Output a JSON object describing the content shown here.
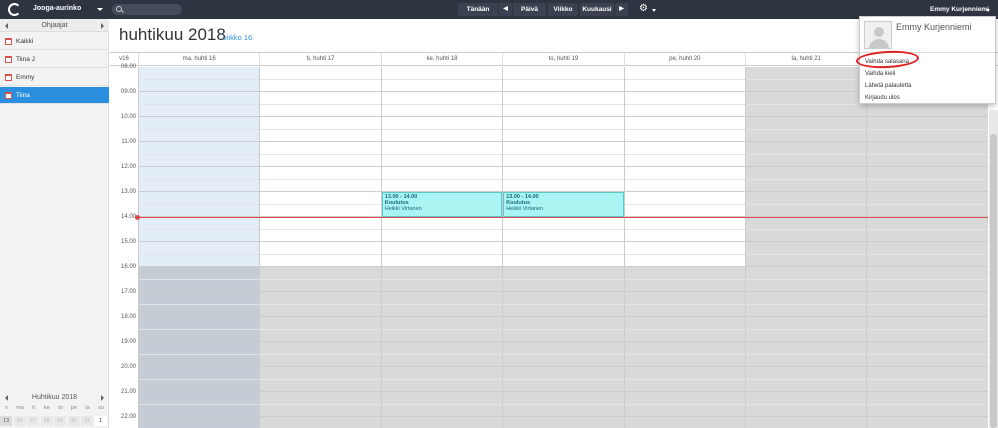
{
  "topbar": {
    "org": "Jooga-aurinko",
    "search_placeholder": "",
    "today": "Tänään",
    "prev": "◀",
    "day": "Päivä",
    "week": "Viikko",
    "month": "Kuukausi",
    "next": "▶",
    "user": "Emmy Kurjenniemi"
  },
  "sidebar": {
    "header": "Ohjaajat",
    "items": [
      {
        "label": "Kaikki"
      },
      {
        "label": "Tiina J"
      },
      {
        "label": "Emmy"
      },
      {
        "label": "Tiina",
        "active": true
      }
    ],
    "mini_calendar": {
      "title": "Huhtikuu 2018",
      "weekdays": [
        "v",
        "ma",
        "ti",
        "ke",
        "to",
        "pe",
        "la",
        "su"
      ],
      "row": [
        "13",
        "26",
        "27",
        "28",
        "29",
        "30",
        "31",
        "1"
      ]
    }
  },
  "main": {
    "title": "huhtikuu 2018",
    "week_label": "viikko 16",
    "week_col": "v16",
    "days": [
      "ma, huhti 16",
      "ti, huhti 17",
      "ke, huhti 18",
      "to, huhti 19",
      "pe, huhti 20",
      "la, huhti 21",
      "su, huhti 22"
    ],
    "hours": [
      "08.00",
      "09.00",
      "10.00",
      "11.00",
      "12.00",
      "13.00",
      "14.00",
      "15.00",
      "16.00",
      "17.00",
      "18.00",
      "19.00",
      "20.00",
      "21.00",
      "22.00"
    ],
    "events": [
      {
        "day": 2,
        "time": "13.00 - 14.00",
        "name": "Koulutus",
        "person": "Heikki Virtanen"
      },
      {
        "day": 3,
        "time": "13.00 - 14.00",
        "name": "Koulutus",
        "person": "Heikki Virtanen"
      }
    ]
  },
  "user_menu": {
    "name": "Emmy Kurjenniemi",
    "items": [
      "Vaihda salasana",
      "Vaihda kieli",
      "Lähetä palautetta",
      "Kirjaudu ulos"
    ]
  },
  "colors": {
    "topbar": "#2f3441",
    "accent": "#2a8fde",
    "event_bg": "#aaf4f4",
    "now_line": "#e04a4a",
    "closed_hours": "#d9d9d9",
    "today_column": "#e3edf8"
  }
}
